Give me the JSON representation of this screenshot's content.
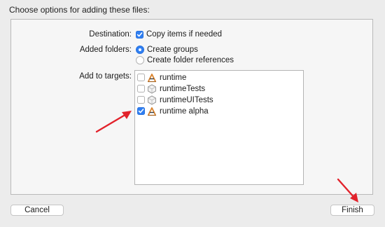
{
  "dialog": {
    "title": "Choose options for adding these files:",
    "destination": {
      "label": "Destination:",
      "option": "Copy items if needed",
      "checked": true
    },
    "added_folders": {
      "label": "Added folders:",
      "options": [
        {
          "label": "Create groups",
          "selected": true
        },
        {
          "label": "Create folder references",
          "selected": false
        }
      ]
    },
    "targets": {
      "label": "Add to targets:",
      "items": [
        {
          "label": "runtime",
          "checked": false,
          "icon": "app-target-icon"
        },
        {
          "label": "runtimeTests",
          "checked": false,
          "icon": "test-bundle-icon"
        },
        {
          "label": "runtimeUITests",
          "checked": false,
          "icon": "test-bundle-icon"
        },
        {
          "label": "runtime alpha",
          "checked": true,
          "icon": "app-target-icon"
        }
      ]
    },
    "buttons": {
      "cancel": "Cancel",
      "finish": "Finish"
    }
  },
  "colors": {
    "accent": "#2f7ff2",
    "annotation": "#e2222b",
    "background": "#ececec"
  }
}
